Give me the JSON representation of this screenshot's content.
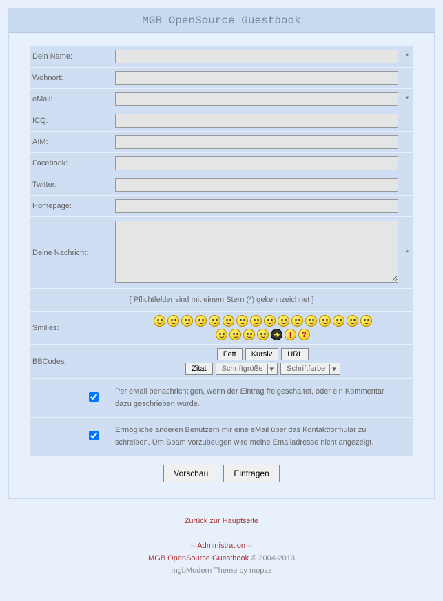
{
  "header": {
    "title": "MGB OpenSource Guestbook"
  },
  "fields": {
    "name": {
      "label": "Dein Name:",
      "required": "*"
    },
    "wohnort": {
      "label": "Wohnort:",
      "required": ""
    },
    "email": {
      "label": "eMail:",
      "required": "*"
    },
    "icq": {
      "label": "ICQ:",
      "required": ""
    },
    "aim": {
      "label": "AIM:",
      "required": ""
    },
    "facebook": {
      "label": "Facebook:",
      "required": ""
    },
    "twitter": {
      "label": "Twitter:",
      "required": ""
    },
    "homepage": {
      "label": "Homepage:",
      "required": ""
    },
    "message": {
      "label": "Deine Nachricht:",
      "required": "*"
    }
  },
  "note": "[ Pflichtfelder sind mit einem Stern (*) gekennzeichnet ]",
  "smilies": {
    "label": "Smilies:"
  },
  "bbcodes": {
    "label": "BBCodes:",
    "fett": "Fett",
    "kursiv": "Kursiv",
    "url": "URL",
    "zitat": "Zitat",
    "schriftgroesse": "Schriftgröße",
    "schriftfarbe": "Schriftfarbe"
  },
  "checkbox1": "Per eMail benachrichtigen, wenn der Eintrag freigeschaltet, oder ein Kommentar dazu geschrieben wurde.",
  "checkbox2": "Ermögliche anderen Benutzern mir eine eMail über das Kontaktformular zu schreiben. Um Spam vorzubeugen wird meine Emailadresse nicht angezeigt.",
  "buttons": {
    "vorschau": "Vorschau",
    "eintragen": "Eintragen"
  },
  "footer": {
    "back": "Zurück zur Hauptseite",
    "admin": "Administration",
    "product": "MGB OpenSource Guestbook",
    "copyright": " © 2004-2013",
    "theme": "mgbModern Theme by mopzz"
  }
}
